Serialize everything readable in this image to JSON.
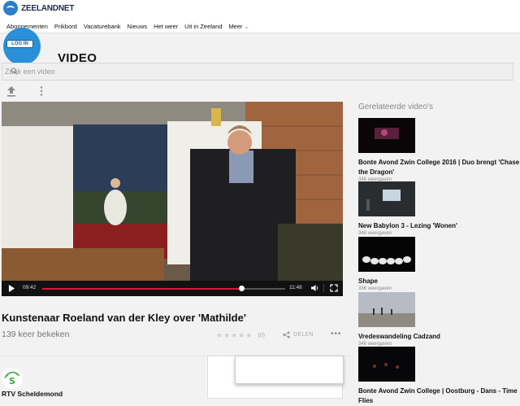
{
  "brand": {
    "logo_text": "ZEELANDNET"
  },
  "nav": {
    "items": [
      "Abonnementen",
      "Prikbord",
      "Vacaturebank",
      "Nieuws",
      "Het weer",
      "Uit in Zeeland"
    ],
    "more_label": "Meer"
  },
  "login": {
    "label": "LOG IN"
  },
  "page": {
    "heading": "VIDEO"
  },
  "search": {
    "placeholder": "Zoek een video"
  },
  "player": {
    "current_time": "09:42",
    "duration": "11:48",
    "progress": 0.82
  },
  "video": {
    "title": "Kunstenaar Roeland van der Kley over 'Mathilde'",
    "views": "139 keer bekeken",
    "rating_count": "(0)",
    "share_label": "DELEN",
    "more_label": "•••"
  },
  "channel": {
    "name": "RTV Scheldemond"
  },
  "sidebar": {
    "heading": "Gerelateerde video's",
    "items": [
      {
        "title": "Bonte Avond Zwin College 2016 | Duo brengt 'Chase the Dragon'",
        "views": "346 weergaven"
      },
      {
        "title": "New Babylon 3 - Lezing 'Wonen'",
        "views": "348 weergaven"
      },
      {
        "title": "Shape",
        "views": "336 weergaven"
      },
      {
        "title": "Vredeswandeling Cadzand",
        "views": "346 weergaven"
      },
      {
        "title": "Bonte Avond Zwin College | Oostburg - Dans - Time Flies",
        "views": ""
      }
    ]
  },
  "colors": {
    "accent": "#2a7fc9",
    "progress": "#d8163a",
    "channel_green": "#3aa83a"
  }
}
